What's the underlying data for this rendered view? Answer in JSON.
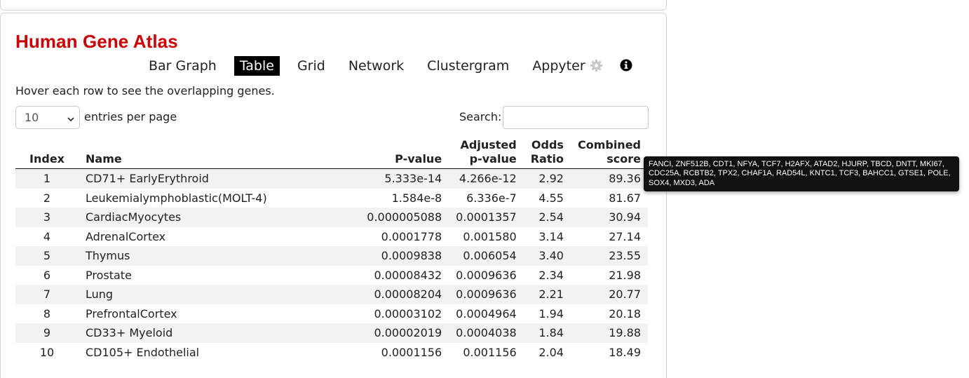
{
  "title": "Human Gene Atlas",
  "tabs": [
    {
      "label": "Bar Graph",
      "active": false
    },
    {
      "label": "Table",
      "active": true
    },
    {
      "label": "Grid",
      "active": false
    },
    {
      "label": "Network",
      "active": false
    },
    {
      "label": "Clustergram",
      "active": false
    },
    {
      "label": "Appyter",
      "active": false
    }
  ],
  "icons": {
    "settings": "gear-icon",
    "info": "info-icon"
  },
  "hint": "Hover each row to see the overlapping genes.",
  "length_menu": {
    "value": "10",
    "label": "entries per page"
  },
  "search": {
    "label": "Search:",
    "value": ""
  },
  "table": {
    "headers": {
      "index": "Index",
      "name": "Name",
      "pvalue": "P-value",
      "adjusted_line1": "Adjusted",
      "adjusted_line2": "p-value",
      "odds_line1": "Odds",
      "odds_line2": "Ratio",
      "combined_line1": "Combined",
      "combined_line2": "score"
    },
    "rows": [
      {
        "index": "1",
        "name": "CD71+ EarlyErythroid",
        "pvalue": "5.333e-14",
        "adjusted": "4.266e-12",
        "odds": "2.92",
        "combined": "89.36"
      },
      {
        "index": "2",
        "name": "Leukemialymphoblastic(MOLT-4)",
        "pvalue": "1.584e-8",
        "adjusted": "6.336e-7",
        "odds": "4.55",
        "combined": "81.67"
      },
      {
        "index": "3",
        "name": "CardiacMyocytes",
        "pvalue": "0.000005088",
        "adjusted": "0.0001357",
        "odds": "2.54",
        "combined": "30.94"
      },
      {
        "index": "4",
        "name": "AdrenalCortex",
        "pvalue": "0.0001778",
        "adjusted": "0.001580",
        "odds": "3.14",
        "combined": "27.14"
      },
      {
        "index": "5",
        "name": "Thymus",
        "pvalue": "0.0009838",
        "adjusted": "0.006054",
        "odds": "3.40",
        "combined": "23.55"
      },
      {
        "index": "6",
        "name": "Prostate",
        "pvalue": "0.00008432",
        "adjusted": "0.0009636",
        "odds": "2.34",
        "combined": "21.98"
      },
      {
        "index": "7",
        "name": "Lung",
        "pvalue": "0.00008204",
        "adjusted": "0.0009636",
        "odds": "2.21",
        "combined": "20.77"
      },
      {
        "index": "8",
        "name": "PrefrontalCortex",
        "pvalue": "0.00003102",
        "adjusted": "0.0004964",
        "odds": "1.94",
        "combined": "20.18"
      },
      {
        "index": "9",
        "name": "CD33+ Myeloid",
        "pvalue": "0.00002019",
        "adjusted": "0.0004038",
        "odds": "1.84",
        "combined": "19.88"
      },
      {
        "index": "10",
        "name": "CD105+ Endothelial",
        "pvalue": "0.0001156",
        "adjusted": "0.001156",
        "odds": "2.04",
        "combined": "18.49"
      }
    ]
  },
  "tooltip": "FANCI, ZNF512B, CDT1, NFYA, TCF7, H2AFX, ATAD2, HJURP, TBCD, DNTT, MKI67, CDC25A, RCBTB2, TPX2, CHAF1A, RAD54L, KNTC1, TCF3, BAHCC1, GTSE1, POLE, SOX4, MXD3, ADA"
}
